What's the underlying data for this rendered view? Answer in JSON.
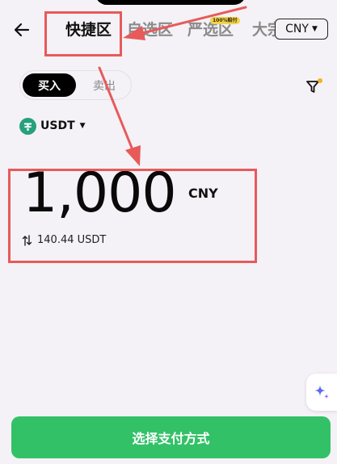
{
  "header": {
    "tabs": [
      {
        "label": "快捷区",
        "active": true
      },
      {
        "label": "自选区",
        "active": false
      },
      {
        "label": "严选区",
        "active": false,
        "badge": "100%赔付"
      },
      {
        "label": "大宗",
        "active": false
      }
    ],
    "currency": "CNY"
  },
  "trade_toggle": {
    "buy_label": "买入",
    "sell_label": "卖出",
    "selected": "buy"
  },
  "coin": {
    "symbol": "USDT"
  },
  "amount": {
    "value": "1,000",
    "unit": "CNY",
    "converted": "140.44 USDT"
  },
  "cta": {
    "label": "选择支付方式"
  },
  "colors": {
    "accent_green": "#33c167",
    "annotation_red": "#e85a5a",
    "tether_teal": "#26a17b",
    "badge_yellow": "#f2d34f"
  },
  "icons": [
    "back-arrow-icon",
    "filter-icon",
    "tether-coin-icon",
    "swap-arrows-icon",
    "sparkle-icon",
    "chevron-down-icon"
  ]
}
